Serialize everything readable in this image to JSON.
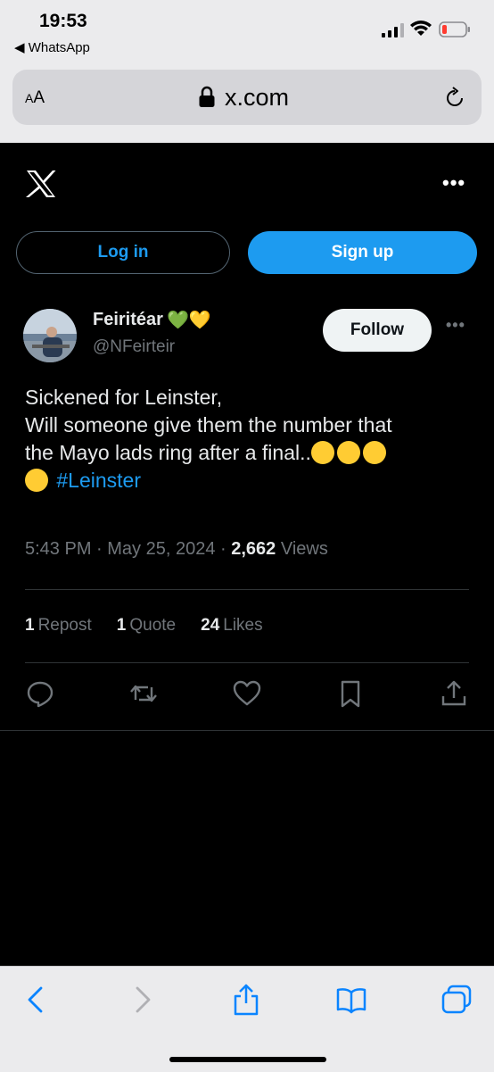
{
  "status": {
    "time": "19:53",
    "back_app": "◀ WhatsApp"
  },
  "browser": {
    "text_size_small": "A",
    "text_size_big": "A",
    "url": "x.com"
  },
  "auth": {
    "login_label": "Log in",
    "signup_label": "Sign up"
  },
  "tweet": {
    "author_name": "Feiritéar",
    "author_hearts": "💚💛",
    "handle": "@NFeirteir",
    "follow_label": "Follow",
    "lines": [
      "Sickened for Leinster,",
      "Will someone give them the number that",
      "the Mayo lads ring after a final.."
    ],
    "hashtag": "#Leinster",
    "time": "5:43 PM",
    "date": "May 25, 2024",
    "views_count": "2,662",
    "views_label": "Views",
    "reposts_count": "1",
    "reposts_label": "Repost",
    "quotes_count": "1",
    "quotes_label": "Quote",
    "likes_count": "24",
    "likes_label": "Likes"
  },
  "colors": {
    "accent": "#1d9bf0",
    "background": "#000000",
    "text": "#e7e9ea",
    "muted": "#71767b",
    "system_blue": "#0a84ff"
  }
}
